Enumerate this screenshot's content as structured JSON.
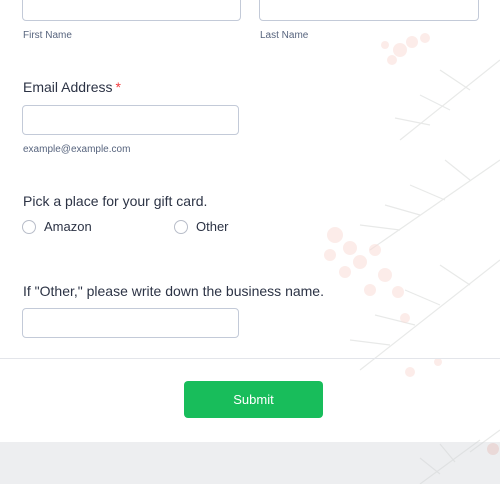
{
  "form": {
    "first_name_sublabel": "First Name",
    "last_name_sublabel": "Last Name",
    "email": {
      "label": "Email Address",
      "required_marker": "*",
      "value": "",
      "sublabel": "example@example.com"
    },
    "gift_card": {
      "label": "Pick a place for your gift card.",
      "options": [
        "Amazon",
        "Other"
      ]
    },
    "other": {
      "label": "If \"Other,\" please write down the business name.",
      "value": ""
    },
    "submit_label": "Submit"
  },
  "colors": {
    "accent": "#18bd5b",
    "required": "#f23a3c",
    "berry": "#e0533a",
    "pine": "#2f3a32"
  }
}
